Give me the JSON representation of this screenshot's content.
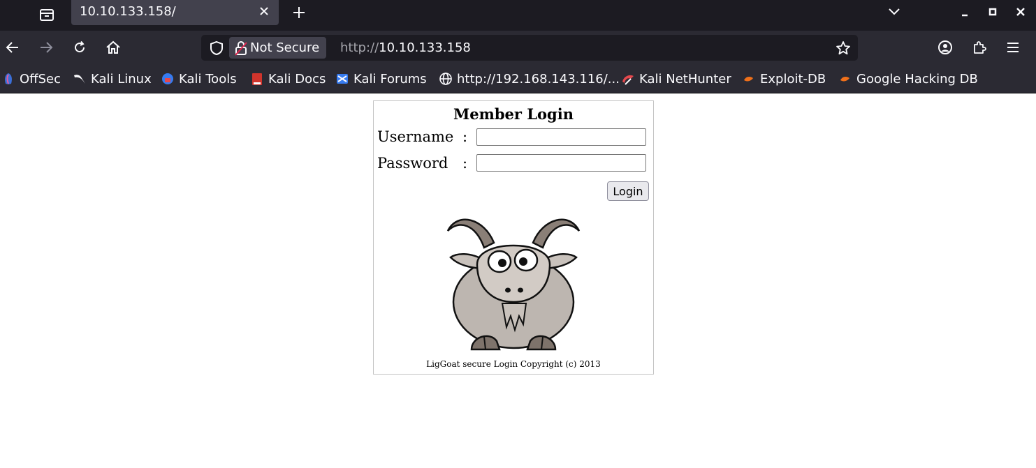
{
  "browser": {
    "tab": {
      "title": "10.10.133.158/"
    },
    "urlbar": {
      "security_label": "Not Secure",
      "url_scheme": "http://",
      "url_host": "10.10.133.158"
    },
    "bookmarks": [
      {
        "label": "OffSec",
        "icon": "offsec-icon"
      },
      {
        "label": "Kali Linux",
        "icon": "kali-dragon-icon"
      },
      {
        "label": "Kali Tools",
        "icon": "kali-tools-icon"
      },
      {
        "label": "Kali Docs",
        "icon": "kali-docs-icon"
      },
      {
        "label": "Kali Forums",
        "icon": "kali-forums-icon"
      },
      {
        "label": "http://192.168.143.116/...",
        "icon": "globe-icon"
      },
      {
        "label": "Kali NetHunter",
        "icon": "nethunter-icon"
      },
      {
        "label": "Exploit-DB",
        "icon": "exploit-db-icon"
      },
      {
        "label": "Google Hacking DB",
        "icon": "ghdb-icon"
      }
    ]
  },
  "page": {
    "title": "Member Login",
    "username_label": "Username",
    "password_label": "Password",
    "colon": ":",
    "username_value": "",
    "password_value": "",
    "login_button": "Login",
    "footer": "LigGoat secure Login Copyright (c) 2013"
  },
  "colors": {
    "tabbar_bg": "#1c1b22",
    "toolbar_bg": "#2b2a33",
    "active_tab_bg": "#42414d",
    "text_light": "#fbfbfe"
  }
}
